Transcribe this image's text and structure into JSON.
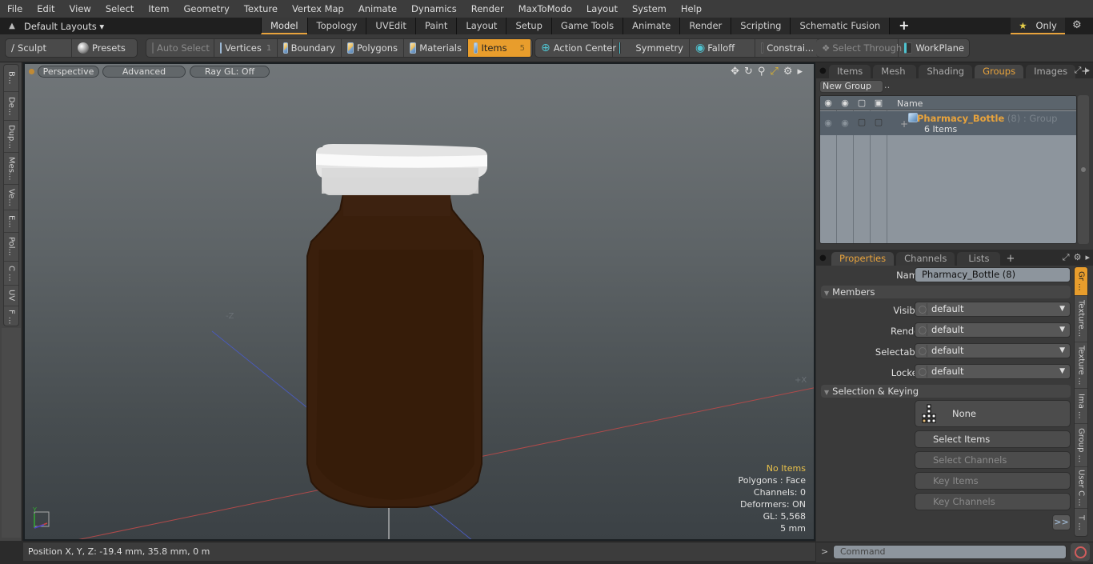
{
  "menubar": {
    "items": [
      "File",
      "Edit",
      "View",
      "Select",
      "Item",
      "Geometry",
      "Texture",
      "Vertex Map",
      "Animate",
      "Dynamics",
      "Render",
      "MaxToModo",
      "Layout",
      "System",
      "Help"
    ]
  },
  "layoutbar": {
    "layouts_label": "Default Layouts ▾",
    "tabs": [
      "Model",
      "Topology",
      "UVEdit",
      "Paint",
      "Layout",
      "Setup",
      "Game Tools",
      "Animate",
      "Render",
      "Scripting",
      "Schematic Fusion"
    ],
    "active_tab": "Model",
    "add_tab": "+",
    "only_label": "Only",
    "only_star": "★"
  },
  "toolbar": {
    "sculpt": "Sculpt",
    "presets": "Presets",
    "auto_select": "Auto Select",
    "vertices": "Vertices",
    "vertices_count": "1",
    "boundary": "Boundary",
    "polygons": "Polygons",
    "materials": "Materials",
    "items": "Items",
    "items_count": "5",
    "action_center": "Action Center",
    "symmetry": "Symmetry",
    "falloff": "Falloff",
    "constraints": "Constrai...",
    "select_through": "Select Through",
    "workplane": "WorkPlane"
  },
  "left_tabs": [
    "B...",
    "De...",
    "Dup...",
    "Mes...",
    "Ve...",
    "E...",
    "Pol...",
    "C ...",
    "UV",
    "F ..."
  ],
  "viewport": {
    "view_mode": "Perspective",
    "shading": "Advanced",
    "raygl": "Ray GL: Off",
    "axis_neg_z": "-Z",
    "axis_pos_x": "+X",
    "info": {
      "selection": "No Items",
      "polygons": "Polygons : Face",
      "channels": "Channels: 0",
      "deformers": "Deformers: ON",
      "gl": "GL: 5,568",
      "grid": "5 mm"
    },
    "colors": {
      "bottle": "#3a1f0c",
      "cap": "#e8e8e8",
      "x_axis": "#b04a4a",
      "z_axis": "#4a5ab8"
    }
  },
  "statusbar": {
    "position": "Position X, Y, Z:   -19.4 mm, 35.8 mm, 0 m"
  },
  "groups_panel": {
    "tabs": [
      "Items",
      "Mesh ...",
      "Shading",
      "Groups",
      "Images"
    ],
    "active_tab": "Groups",
    "new_group": "New Group",
    "column_name": "Name",
    "group": {
      "name": "Pharmacy_Bottle",
      "suffix": " (8) : Group",
      "items": "6 Items"
    }
  },
  "properties_panel": {
    "tabs": [
      "Properties",
      "Channels",
      "Lists"
    ],
    "active_tab": "Properties",
    "name_label": "Name",
    "name_value": "Pharmacy_Bottle (8)",
    "members_section": "Members",
    "fields": [
      {
        "label": "Visible",
        "value": "default"
      },
      {
        "label": "Render",
        "value": "default"
      },
      {
        "label": "Selectable",
        "value": "default"
      },
      {
        "label": "Locked",
        "value": "default"
      }
    ],
    "selection_section": "Selection & Keying",
    "none_button": "None",
    "select_items": "Select Items",
    "select_channels": "Select Channels",
    "key_items": "Key Items",
    "key_channels": "Key Channels",
    "more": ">>",
    "side_tabs": [
      "Gr ...",
      "Texture...",
      "Texture ...",
      "Ima ...",
      "Group ...",
      "User C ...",
      "T ..."
    ]
  },
  "command": {
    "prompt": ">",
    "placeholder": "Command"
  },
  "accent_color": "#e89d2c"
}
